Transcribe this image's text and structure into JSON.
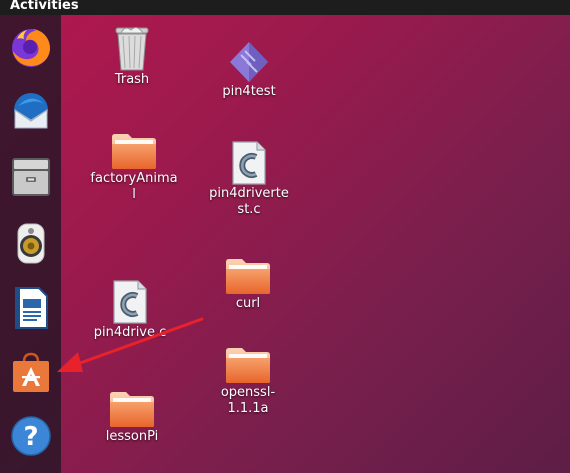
{
  "topbar": {
    "activities_label": "Activities"
  },
  "dock": {
    "items": [
      {
        "icon": "firefox-icon"
      },
      {
        "icon": "thunderbird-icon"
      },
      {
        "icon": "files-icon"
      },
      {
        "icon": "rhythmbox-icon"
      },
      {
        "icon": "libreoffice-writer-icon"
      },
      {
        "icon": "software-center-icon"
      },
      {
        "icon": "help-icon"
      }
    ]
  },
  "desktop": {
    "icons": [
      {
        "label": "Trash",
        "type": "trash"
      },
      {
        "label": "pin4test",
        "type": "executable"
      },
      {
        "label": "factoryAnimal",
        "type": "folder"
      },
      {
        "label": "pin4drivertest.c",
        "type": "c-source"
      },
      {
        "label": "curl",
        "type": "folder"
      },
      {
        "label": "pin4drive.c",
        "type": "c-source"
      },
      {
        "label": "openssl-1.1.1a",
        "type": "folder"
      },
      {
        "label": "lessonPi",
        "type": "folder"
      }
    ]
  },
  "colors": {
    "folder": "#e9773e",
    "folder_light": "#f7a977",
    "annotation_arrow": "#e8222a",
    "dock_bg": "#261626"
  }
}
